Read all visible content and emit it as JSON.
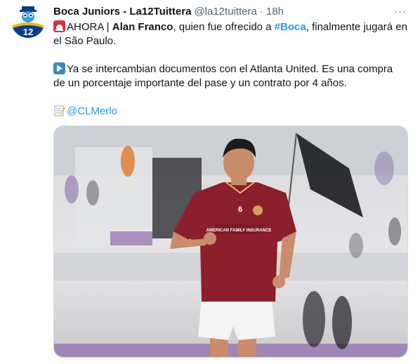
{
  "author": {
    "display_name": "Boca Juniors - La12Tuittera",
    "handle": "@la12tuittera",
    "separator": "·",
    "time": "18h",
    "avatar_icon": "la12-mascot-logo",
    "avatar_text": "12"
  },
  "more_icon": "more-dots-icon",
  "more_label": "···",
  "text": {
    "line1_prefix": "AHORA | ",
    "line1_bold": "Alan Franco",
    "line1_mid": ", quien fue ofrecido a ",
    "line1_hashtag": "#Boca",
    "line1_suffix": ", finalmente jugará en",
    "line2": "el São Paulo.",
    "line3": "Ya se intercambian documentos con el Atlanta United. Es una compra",
    "line4": "de un porcentaje importante del pase y un contrato por 4 años.",
    "line5_mention": "@CLMerlo"
  },
  "emojis": [
    "rotating-light-emoji",
    "play-button-emoji",
    "memo-emoji"
  ],
  "media": {
    "alt": "player-photo",
    "jersey_number": "6",
    "sponsor": "AMERICAN FAMILY INSURANCE"
  },
  "colors": {
    "link": "#1d9bf0",
    "text": "#0f1419",
    "muted": "#536471",
    "jersey": "#8c1f2c"
  }
}
